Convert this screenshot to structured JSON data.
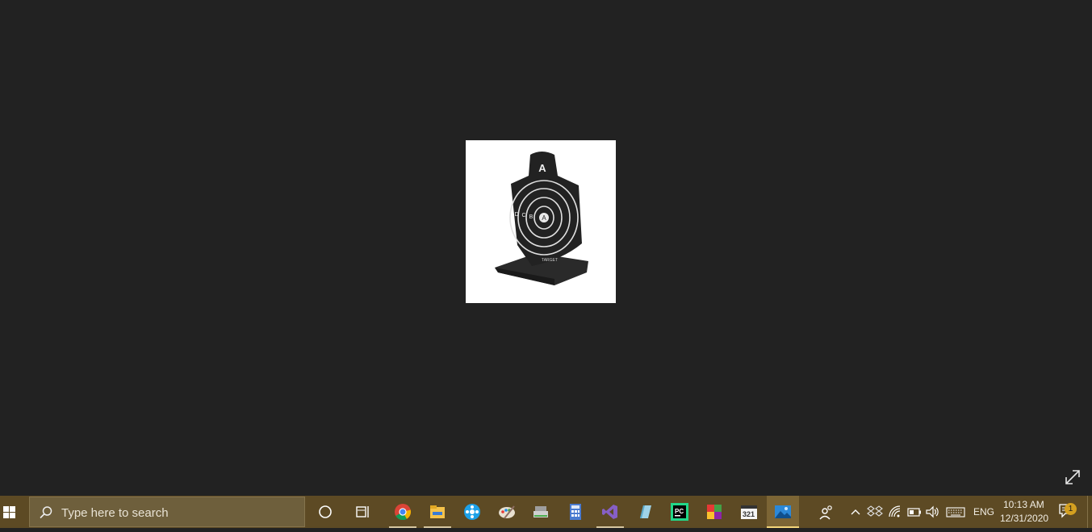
{
  "search": {
    "placeholder": "Type here to search"
  },
  "tray": {
    "language": "ENG",
    "time": "10:13 AM",
    "date": "12/31/2020",
    "notification_count": "1"
  },
  "taskbar_apps": [
    "cortana-icon",
    "task-view-icon",
    "chrome-icon",
    "file-explorer-icon",
    "media-app-icon",
    "paint-app-icon",
    "scanner-app-icon",
    "calculator-icon",
    "visual-studio-icon",
    "notepad-app-icon",
    "pycharm-icon",
    "colorful-app-icon",
    "media-player-classic-icon",
    "photos-icon"
  ],
  "photo_labels": {
    "top": "A",
    "center": "A",
    "b": "B",
    "c": "C",
    "d": "D",
    "base": "TARGET"
  },
  "colors": {
    "viewer_bg": "#222222",
    "taskbar_bg": "#5d4a24",
    "accent": "#f4d67a"
  }
}
